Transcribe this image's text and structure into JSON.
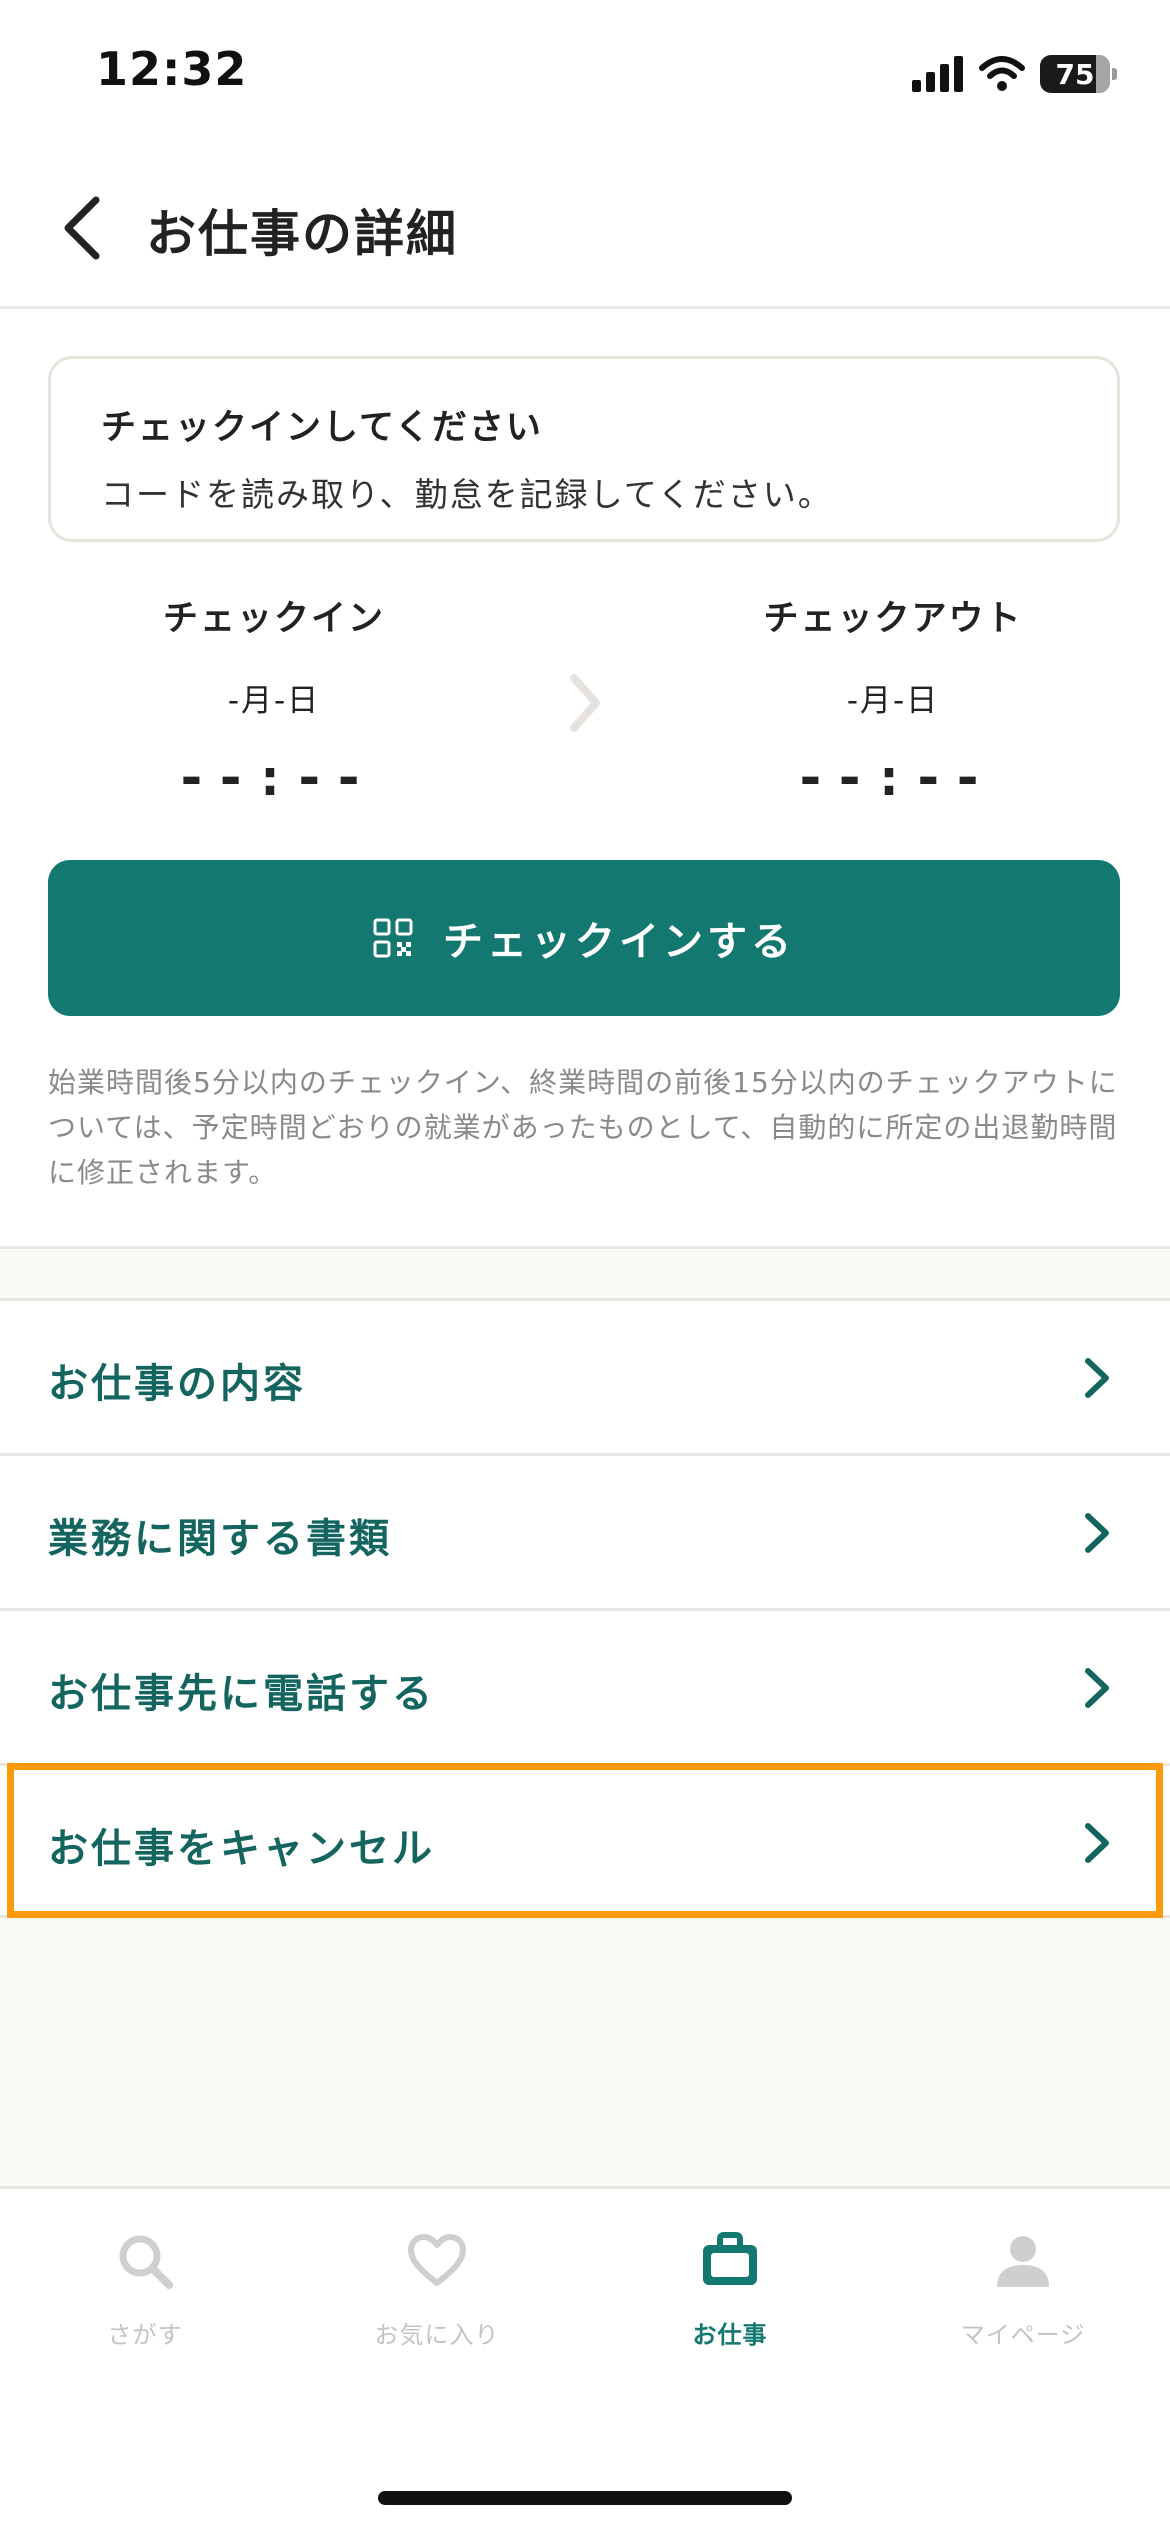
{
  "status_bar": {
    "time": "12:32",
    "battery": "75"
  },
  "header": {
    "title": "お仕事の詳細"
  },
  "notice": {
    "title": "チェックインしてください",
    "body": "コードを読み取り、勤怠を記録してください。"
  },
  "checkin": {
    "label": "チェックイン",
    "date": "-月-日",
    "time": "--:--"
  },
  "checkout": {
    "label": "チェックアウト",
    "date": "-月-日",
    "time": "--:--"
  },
  "checkin_button": {
    "label": "チェックインする",
    "icon": "qr-code-icon"
  },
  "note": "始業時間後5分以内のチェックイン、終業時間の前後15分以内のチェックアウトについては、予定時間どおりの就業があったものとして、自動的に所定の出退勤時間に修正されます。",
  "menu": {
    "items": [
      {
        "label": "お仕事の内容"
      },
      {
        "label": "業務に関する書類"
      },
      {
        "label": "お仕事先に電話する"
      },
      {
        "label": "お仕事をキャンセル"
      }
    ]
  },
  "tabbar": {
    "tabs": [
      {
        "label": "さがす",
        "icon": "search-icon"
      },
      {
        "label": "お気に入り",
        "icon": "heart-icon"
      },
      {
        "label": "お仕事",
        "icon": "briefcase-icon",
        "active": true
      },
      {
        "label": "マイページ",
        "icon": "person-icon"
      }
    ]
  },
  "colors": {
    "primary": "#137870",
    "menu_text": "#14655f",
    "highlight": "#fd9a0b",
    "background_beige": "#fbfaf6"
  }
}
